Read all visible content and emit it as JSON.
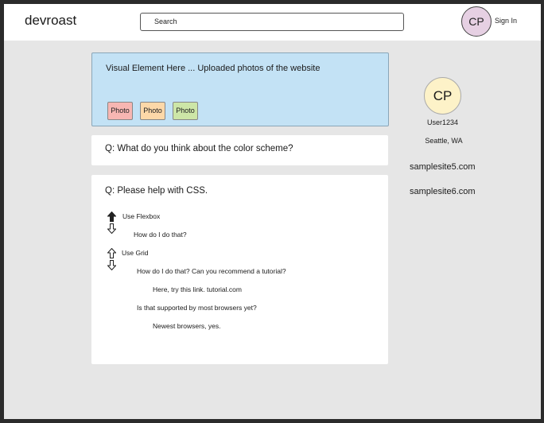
{
  "header": {
    "logo": "devroast",
    "search_placeholder": "Search",
    "avatar_initials": "CP",
    "sign_in": "Sign In"
  },
  "visual_card": {
    "text": "Visual Element Here ... Uploaded photos of the website",
    "photos": [
      {
        "label": "Photo",
        "color": "#f7b6b2"
      },
      {
        "label": "Photo",
        "color": "#fdd8a8"
      },
      {
        "label": "Photo",
        "color": "#cde6a7"
      }
    ]
  },
  "questions": [
    {
      "title": "Q: What do you think about the color scheme?"
    },
    {
      "title": "Q: Please help with CSS.",
      "answers": [
        {
          "text": "Use Flexbox",
          "upvoted": true
        },
        {
          "text": "How do I do that?"
        },
        {
          "text": "Use Grid",
          "upvoted": false
        },
        {
          "text": "How do I do that? Can you recommend a tutorial?"
        },
        {
          "text": "Here, try this link. tutorial.com"
        },
        {
          "text": "Is that supported by most browsers yet?"
        },
        {
          "text": "Newest browsers, yes."
        }
      ]
    }
  ],
  "profile": {
    "initials": "CP",
    "username": "User1234",
    "location": "Seattle, WA"
  },
  "side_links": [
    "samplesite5.com",
    "samplesite6.com"
  ]
}
